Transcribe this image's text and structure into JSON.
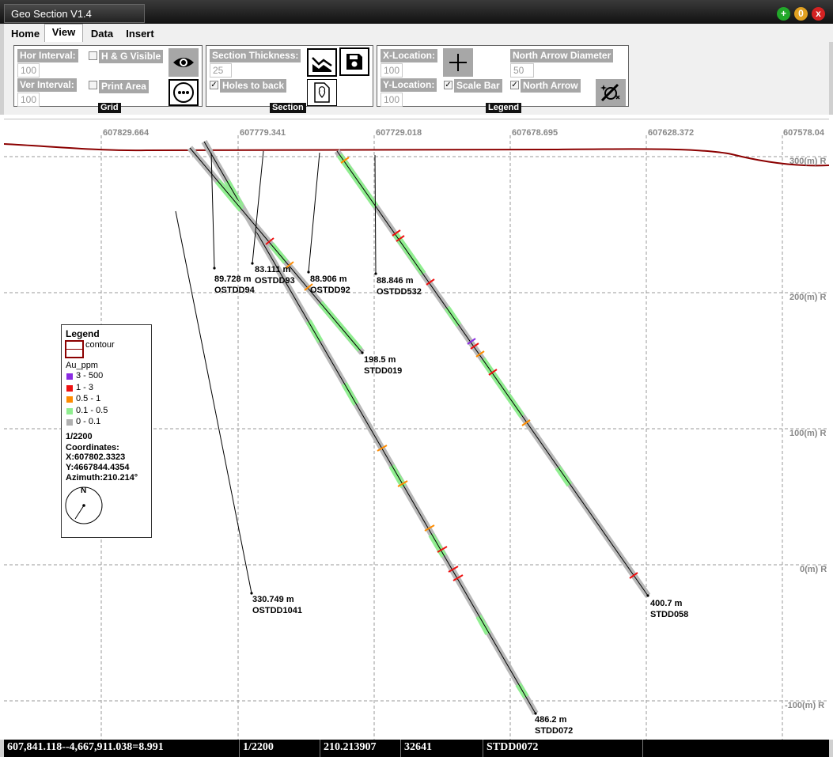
{
  "window": {
    "title": "Geo Section V1.4",
    "buttons": [
      {
        "name": "maximize",
        "glyph": "+",
        "color": "#22a82a"
      },
      {
        "name": "minimize",
        "glyph": "0",
        "color": "#e0a020"
      },
      {
        "name": "close",
        "glyph": "x",
        "color": "#d42222"
      }
    ]
  },
  "tabs": [
    "Home",
    "View",
    "Data",
    "Insert"
  ],
  "active_tab": "View",
  "ribbon": {
    "grid": {
      "label": "Grid",
      "hor_interval_label": "Hor Interval:",
      "hor_interval_value": "100",
      "ver_interval_label": "Ver Interval:",
      "ver_interval_value": "100",
      "hg_visible_label": "H & G Visible",
      "hg_visible_checked": false,
      "print_area_label": "Print Area",
      "print_area_checked": false,
      "visibility_icon": "eye-icon",
      "more_icon": "more-dots-icon"
    },
    "section": {
      "label": "Section",
      "thickness_label": "Section Thickness:",
      "thickness_value": "25",
      "holes_to_back_label": "Holes to back",
      "holes_to_back_checked": true,
      "profile_icon": "terrain-profile-icon",
      "save_icon": "save-icon",
      "location_icon": "map-pin-file-icon"
    },
    "legend": {
      "label": "Legend",
      "x_location_label": "X-Location:",
      "x_location_value": "100",
      "y_location_label": "Y-Location:",
      "y_location_value": "100",
      "scale_bar_label": "Scale Bar",
      "scale_bar_checked": true,
      "north_arrow_label": "North Arrow",
      "north_arrow_checked": true,
      "north_arrow_diameter_label": "North Arrow Diameter",
      "north_arrow_diameter_value": "50",
      "crosshair_icon": "crosshair-icon",
      "magic_icon": "magic-wand-icon"
    }
  },
  "section_view": {
    "x_ticks": [
      "607829.664",
      "607779.341",
      "607729.018",
      "607678.695",
      "607628.372",
      "607578.04"
    ],
    "y_ticks": [
      "300(m) R",
      "200(m) R",
      "100(m) R",
      "0(m) R",
      "-100(m) R"
    ],
    "contour_color": "#8b0000",
    "holes": [
      {
        "depth": "89.728 m",
        "name": "OSTDD94"
      },
      {
        "depth": "83.111 m",
        "name": "OSTDD93"
      },
      {
        "depth": "88.906 m",
        "name": "OSTDD92"
      },
      {
        "depth": "88.846 m",
        "name": "OSTDD532"
      },
      {
        "depth": "198.5 m",
        "name": "STDD019"
      },
      {
        "depth": "330.749 m",
        "name": "OSTDD1041"
      },
      {
        "depth": "400.7 m",
        "name": "STDD058"
      },
      {
        "depth": "486.2 m",
        "name": "STDD072"
      }
    ]
  },
  "legend_box": {
    "title": "Legend",
    "contour_label": "contour",
    "au_label": "Au_ppm",
    "classes": [
      {
        "label": "3 - 500",
        "color": "#8a2be2"
      },
      {
        "label": "1 - 3",
        "color": "#ee1111"
      },
      {
        "label": "0.5 - 1",
        "color": "#ff8c00"
      },
      {
        "label": "0.1 - 0.5",
        "color": "#90ee90"
      },
      {
        "label": "0 - 0.1",
        "color": "#b0b0b0"
      }
    ],
    "scale": "1/2200",
    "coordinates_label": "Coordinates:",
    "x_coord": "X:607802.3323",
    "y_coord": "Y:4667844.4354",
    "azimuth": "Azimuth:210.214°",
    "north_label": "N"
  },
  "status_bar": {
    "cursor": "607,841.118--4,667,911.038=8.991",
    "scale": "1/2200",
    "azimuth": "210.213907",
    "count": "32641",
    "hole": "STDD0072"
  }
}
